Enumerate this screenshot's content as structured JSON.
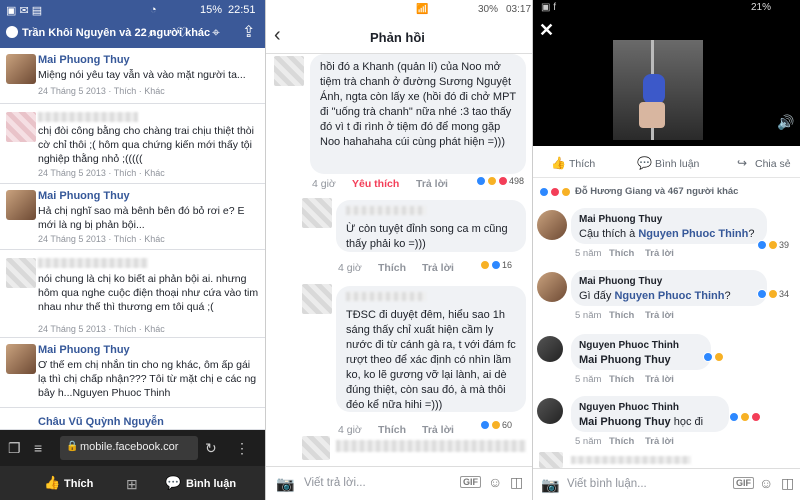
{
  "panel1": {
    "status": {
      "battery": "15%",
      "time": "22:51"
    },
    "header_title": "Trần Khôi Nguyên và 22 người khác",
    "comments": [
      {
        "name": "Mai Phuong Thuy",
        "text": "Miệng nói yêu tay vẫn và vào mặt người ta...",
        "meta": "24 Tháng 5 2013 · Thích · Khác"
      },
      {
        "name": "",
        "text": "chị đòi công bằng cho chàng trai chịu thiệt thòi cờ chỉ thôi ;( hôm qua chứng kiến mới thấy tội nghiệp thằng nhỏ ;(((((",
        "meta": "24 Tháng 5 2013 · Thích · Khác"
      },
      {
        "name": "Mai Phuong Thuy",
        "text": "Hả chị nghĩ sao mà bênh bên đó bỏ rơi e? E mới là ng bị phản bội...",
        "meta": "24 Tháng 5 2013 · Thích · Khác"
      },
      {
        "name": "",
        "text": "nói chung là chị ko biết ai phản bội ai. nhưng hôm qua nghe cuộc điện thoại như cứa vào tim nhau như thế thì thương em tôi quá ;(",
        "meta": "24 Tháng 5 2013 · Thích · Khác"
      },
      {
        "name": "Mai Phuong Thuy",
        "text": "Ơ thế em chị nhắn tin cho ng khác, ôm ấp gái lạ thì chị chấp nhận??? Tôi từ mặt chị e các ng bây h...Nguyen Phuoc Thinh",
        "meta": ""
      },
      {
        "name": "Châu Vũ Quỳnh Nguyễn",
        "text": "",
        "meta": ""
      }
    ],
    "url": "mobile.facebook.cor",
    "bottom_like": "Thích",
    "bottom_comment": "Bình luận"
  },
  "panel2": {
    "status": {
      "battery": "30%",
      "time": "03:17"
    },
    "title": "Phản hồi",
    "comments": [
      {
        "text": "hồi đó a Khanh (quản lí) của Noo mở tiệm trà chanh ở đường Sương Nguyệt Ánh, ngta còn lấy xe (hồi đó đi        chở MPT đi \"uống trà chanh\" nữa nhé :3 tao thấy đó vì t đi rình ở tiệm đó để mong gặp Noo hahahaha cúi cùng phát hiện =)))",
        "time": "4 giờ",
        "like": "Yêu thích",
        "reply": "Trả lời",
        "count": "498"
      },
      {
        "text": "Ừ  còn tuyệt đỉnh song ca m cũng thấy phải ko =)))",
        "time": "4 giờ",
        "like": "Thích",
        "reply": "Trả lời",
        "count": "16"
      },
      {
        "text": "TĐSC đi duyệt đêm,        hiểu sao 1h sáng thấy chỉ xuất hiện cầm ly nước đi từ cánh gà ra, t với đám fc rượt theo để xác định có nhìn lầm ko, ko lẽ gương vỡ lại lành, ai dè đúng thiệt, còn sau đó, à mà thôi đéo kể nữa hihi =)))",
        "time": "4 giờ",
        "like": "Thích",
        "reply": "Trả lời",
        "count": "60"
      }
    ],
    "input_placeholder": "Viết trả lời...",
    "gif": "GIF"
  },
  "panel3": {
    "status": {
      "battery": "21%",
      "time": ""
    },
    "actions": {
      "like": "Thích",
      "comment": "Bình luận",
      "share": "Chia sẻ"
    },
    "reactions_text": "Đỗ Hương Giang và 467 người khác",
    "comments": [
      {
        "name": "Mai Phuong Thuy",
        "text": "Cậu thích à ",
        "tag": "Nguyen Phuoc Thinh",
        "suffix": "?",
        "time": "5 năm",
        "like": "Thích",
        "reply": "Trả lời",
        "count": "39"
      },
      {
        "name": "Mai Phuong Thuy",
        "text": "Gì đấy ",
        "tag": "Nguyen Phuoc Thinh",
        "suffix": "?",
        "time": "5 năm",
        "like": "Thích",
        "reply": "Trả lời",
        "count": "34"
      },
      {
        "name": "Nguyen Phuoc Thinh",
        "text": "",
        "tag": "Mai Phuong Thuy",
        "suffix": "",
        "time": "5 năm",
        "like": "Thích",
        "reply": "Trả lời",
        "count": ""
      },
      {
        "name": "Nguyen Phuoc Thinh",
        "text": "",
        "tag": "Mai Phuong Thuy",
        "suffix": " học đi",
        "time": "5 năm",
        "like": "Thích",
        "reply": "Trả lời",
        "count": ""
      }
    ],
    "input_placeholder": "Viết bình luận...",
    "gif": "GIF"
  }
}
